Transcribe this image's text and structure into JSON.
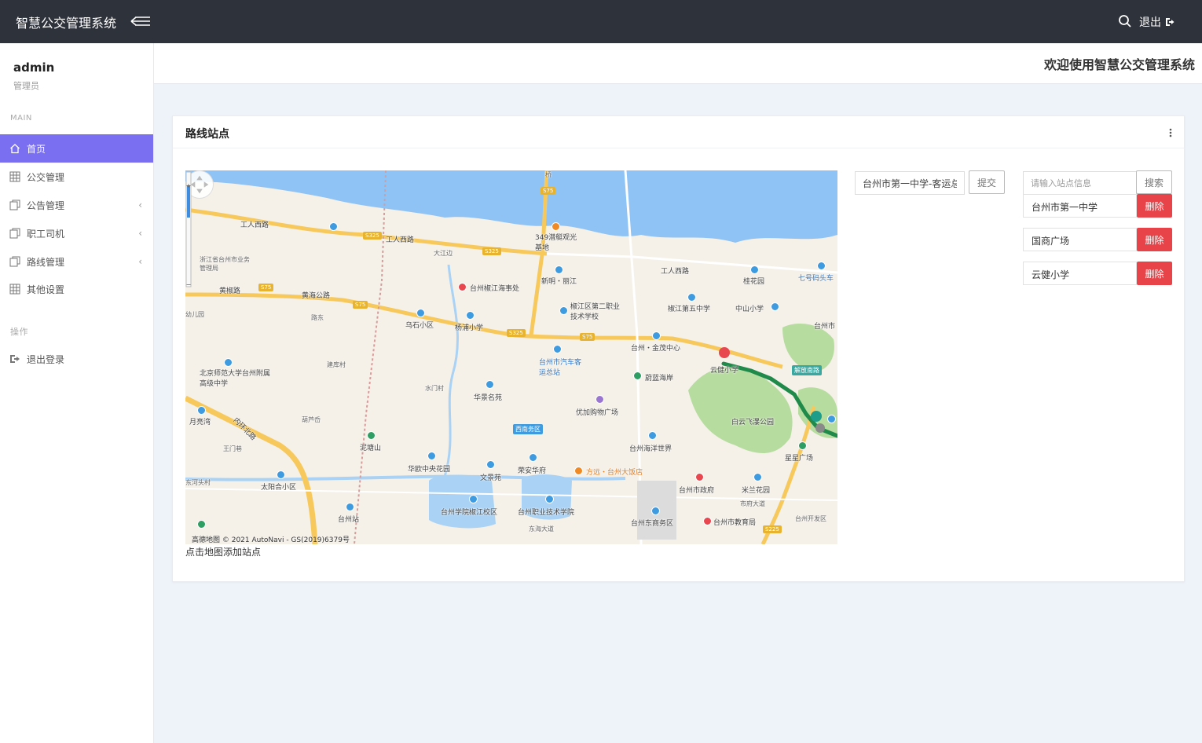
{
  "app": {
    "title": "智慧公交管理系统",
    "logout_label": "退出"
  },
  "sidebar": {
    "user_name": "admin",
    "user_role": "管理员",
    "section_main": "MAIN",
    "section_ops": "操作",
    "items": [
      {
        "label": "首页",
        "icon": "home-icon",
        "active": true
      },
      {
        "label": "公交管理",
        "icon": "grid-icon"
      },
      {
        "label": "公告管理",
        "icon": "copy-icon",
        "has_submenu": true
      },
      {
        "label": "职工司机",
        "icon": "copy-icon",
        "has_submenu": true
      },
      {
        "label": "路线管理",
        "icon": "copy-icon",
        "has_submenu": true
      },
      {
        "label": "其他设置",
        "icon": "grid-icon"
      }
    ],
    "logout_item": "退出登录"
  },
  "header": {
    "welcome": "欢迎使用智慧公交管理系统"
  },
  "card": {
    "title": "路线站点"
  },
  "route_form": {
    "route_value": "台州市第一中学-客运总站",
    "submit_label": "提交"
  },
  "station_search": {
    "placeholder": "请输入站点信息",
    "button_label": "搜索"
  },
  "stations": [
    {
      "name": "台州市第一中学",
      "delete_label": "删除"
    },
    {
      "name": "国商广场",
      "delete_label": "删除"
    },
    {
      "name": "云健小学",
      "delete_label": "删除"
    }
  ],
  "map": {
    "hint": "点击地图添加站点",
    "copyright": "高德地图 © 2021 AutoNavi - GS(2019)6379号",
    "colors": {
      "water": "#8fc3f5",
      "land": "#f5f1e9",
      "road": "#f7c95c",
      "green": "#a8d48c",
      "route": "#1f8a4a"
    },
    "labels": [
      "工人西路",
      "工人西路",
      "工人西路",
      "黄椒路",
      "黄海公路",
      "浙江省台州市业务管理局",
      "路东",
      "建库村",
      "乌石小区",
      "杨浦小学",
      "台州椒江海事处",
      "新明・丽江",
      "349潜艇观光基地",
      "大江边",
      "椒江区第二职业技术学校",
      "椒江第五中学",
      "中山小学",
      "桂花园",
      "七号码头车",
      "台州・金茂中心",
      "台州市汽车客运总站",
      "蔚蓝海岸",
      "云健小学",
      "解放南路",
      "白云飞瀑公园",
      "北京师范大学台州附属高级中学",
      "水门村",
      "华景名苑",
      "优加购物广场",
      "西南务区",
      "月亮湾",
      "内环北路",
      "王门巷",
      "葫芦岙",
      "泥塘山",
      "华欧中央花园",
      "文景苑",
      "荣安华府",
      "方远・台州大饭店",
      "台州海洋世界",
      "星星广场",
      "台州市政府",
      "米兰花园",
      "台州学院椒江校区",
      "台州职业技术学院",
      "东海大道",
      "台州东商务区",
      "台州市教育局",
      "市府大道",
      "台州开发区",
      "太阳合小区",
      "东河头村",
      "台州站",
      "台州市",
      "幼儿园",
      "桥"
    ],
    "road_badges": [
      "S75",
      "S325",
      "S325",
      "S75",
      "S75",
      "S325",
      "S75",
      "S225"
    ]
  }
}
